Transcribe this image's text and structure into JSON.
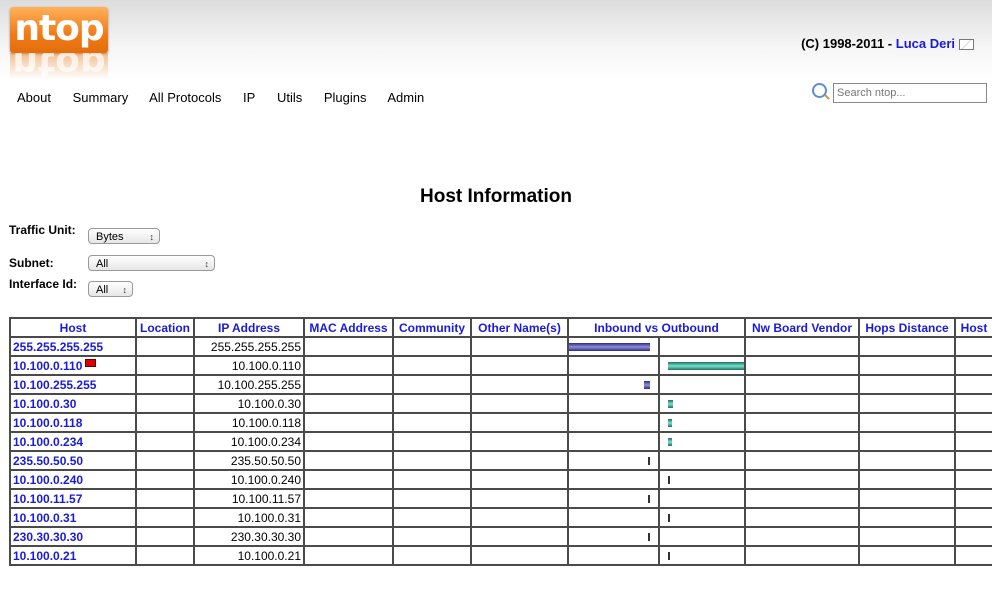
{
  "header": {
    "logo_text": "ntop",
    "copyright_prefix": "(C) 1998-2011 - ",
    "author": "Luca Deri"
  },
  "nav": [
    "About",
    "Summary",
    "All Protocols",
    "IP",
    "Utils",
    "Plugins",
    "Admin"
  ],
  "search": {
    "placeholder": "Search ntop..."
  },
  "page": {
    "title": "Host Information"
  },
  "filters": {
    "traffic_unit": {
      "label": "Traffic Unit:",
      "value": "Bytes"
    },
    "subnet": {
      "label": "Subnet:",
      "value": "All"
    },
    "interface": {
      "label": "Interface Id:",
      "value": "All"
    }
  },
  "table": {
    "columns": [
      "Host",
      "Location",
      "IP Address",
      "MAC Address",
      "Community",
      "Other Name(s)",
      "Inbound vs Outbound",
      "Nw Board Vendor",
      "Hops Distance",
      "Host"
    ],
    "rows": [
      {
        "host": "255.255.255.255",
        "ip": "255.255.255.255",
        "flag": false,
        "inbound": 1.0,
        "outbound": 0.0
      },
      {
        "host": "10.100.0.110",
        "ip": "10.100.0.110",
        "flag": true,
        "inbound": 0.0,
        "outbound": 1.0
      },
      {
        "host": "10.100.255.255",
        "ip": "10.100.255.255",
        "flag": false,
        "inbound": 0.07,
        "outbound": 0.0
      },
      {
        "host": "10.100.0.30",
        "ip": "10.100.0.30",
        "flag": false,
        "inbound": 0.0,
        "outbound": 0.06
      },
      {
        "host": "10.100.0.118",
        "ip": "10.100.0.118",
        "flag": false,
        "inbound": 0.0,
        "outbound": 0.05
      },
      {
        "host": "10.100.0.234",
        "ip": "10.100.0.234",
        "flag": false,
        "inbound": 0.0,
        "outbound": 0.05
      },
      {
        "host": "235.50.50.50",
        "ip": "235.50.50.50",
        "flag": false,
        "inbound": 0.02,
        "outbound": 0.0
      },
      {
        "host": "10.100.0.240",
        "ip": "10.100.0.240",
        "flag": false,
        "inbound": 0.0,
        "outbound": 0.02
      },
      {
        "host": "10.100.11.57",
        "ip": "10.100.11.57",
        "flag": false,
        "inbound": 0.01,
        "outbound": 0.0
      },
      {
        "host": "10.100.0.31",
        "ip": "10.100.0.31",
        "flag": false,
        "inbound": 0.0,
        "outbound": 0.01
      },
      {
        "host": "230.30.30.30",
        "ip": "230.30.30.30",
        "flag": false,
        "inbound": 0.01,
        "outbound": 0.0
      },
      {
        "host": "10.100.0.21",
        "ip": "10.100.0.21",
        "flag": false,
        "inbound": 0.0,
        "outbound": 0.01
      }
    ]
  },
  "colors": {
    "link": "#1a1adb",
    "inbound_bar": "#2b2b7a",
    "outbound_bar": "#1f6f62",
    "logo": "#f07b16"
  }
}
